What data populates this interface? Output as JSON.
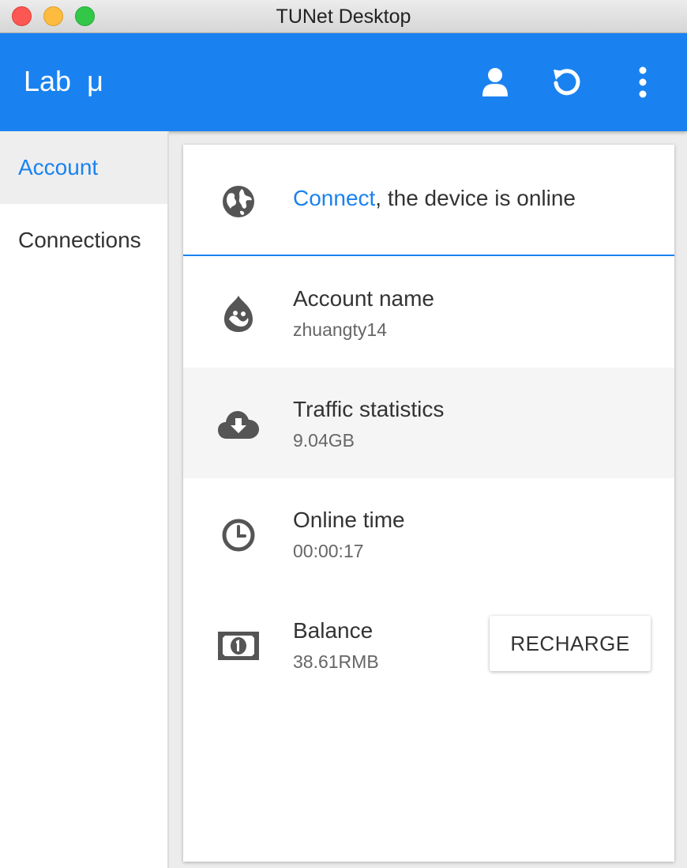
{
  "window": {
    "title": "TUNet Desktop"
  },
  "appbar": {
    "title": "Lab  μ",
    "icons": [
      "user-icon",
      "refresh-icon",
      "more-vert-icon"
    ]
  },
  "sidebar": {
    "items": [
      {
        "label": "Account",
        "active": true
      },
      {
        "label": "Connections",
        "active": false
      }
    ]
  },
  "status": {
    "link_text": "Connect",
    "message": ", the device is online",
    "icon": "globe-icon"
  },
  "account": {
    "name_label": "Account name",
    "name_value": "zhuangty14",
    "traffic_label": "Traffic statistics",
    "traffic_value": "9.04GB",
    "online_label": "Online time",
    "online_value": "00:00:17",
    "balance_label": "Balance",
    "balance_value": "38.61RMB",
    "recharge_label": "RECHARGE"
  },
  "colors": {
    "accent": "#1a82f0",
    "icon": "#555555"
  }
}
